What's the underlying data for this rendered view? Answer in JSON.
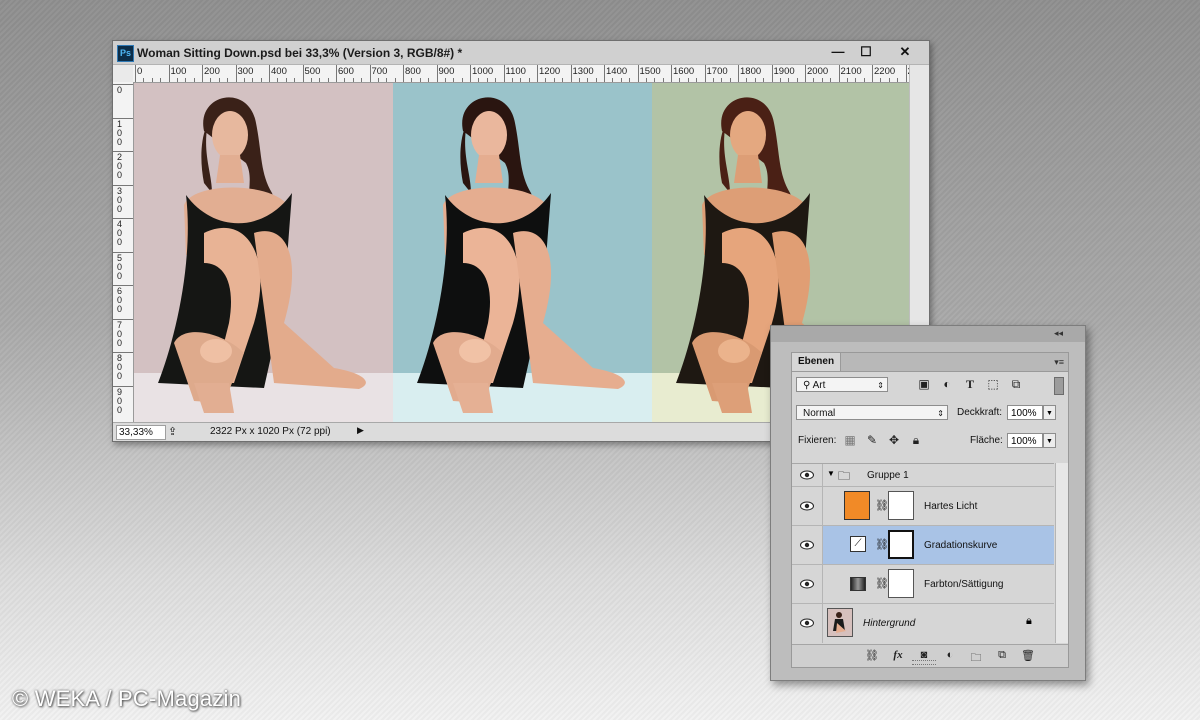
{
  "document": {
    "title": "Woman Sitting Down.psd bei 33,3% (Version 3, RGB/8#) *",
    "app_icon": "Ps",
    "window_controls": {
      "minimize": "—",
      "maximize": "☐",
      "close": "✕"
    },
    "ruler_h_labels": [
      "0",
      "100",
      "200",
      "300",
      "400",
      "500",
      "600",
      "700",
      "800",
      "900",
      "1000",
      "1100",
      "1200",
      "1300",
      "1400",
      "1500",
      "1600",
      "1700",
      "1800",
      "1900",
      "2000",
      "2100",
      "2200",
      "2"
    ],
    "ruler_v_labels": [
      "0",
      "1\n0\n0",
      "2\n0\n0",
      "3\n0\n0",
      "4\n0\n0",
      "5\n0\n0",
      "6\n0\n0",
      "7\n0\n0",
      "8\n0\n0",
      "9\n0\n0"
    ],
    "zoom": "33,33%",
    "doc_info": "2322 Px x 1020 Px (72 ppi)",
    "panels": [
      {
        "bg": "#d4c2c3",
        "tint": "none"
      },
      {
        "bg": "#9cc4cb",
        "tint": "cool"
      },
      {
        "bg": "#b3c3a7",
        "tint": "warm"
      }
    ]
  },
  "layers_panel": {
    "tab_label": "Ebenen",
    "collapse_icon": "◂◂",
    "menu_icon": "▾≡",
    "filter_label": "Art",
    "filter_icons": [
      "image-icon",
      "adjustment-icon",
      "T",
      "shape-icon",
      "smart-object-icon"
    ],
    "blend_mode": "Normal",
    "opacity_label": "Deckkraft:",
    "opacity_value": "100%",
    "lock_label": "Fixieren:",
    "fill_label": "Fläche:",
    "fill_value": "100%",
    "group": {
      "name": "Gruppe 1"
    },
    "layers": [
      {
        "name": "Hartes Licht",
        "type": "fill",
        "color": "#f18a27"
      },
      {
        "name": "Gradationskurve",
        "type": "curves",
        "selected": true
      },
      {
        "name": "Farbton/Sättigung",
        "type": "hue-saturation"
      },
      {
        "name": "Hintergrund",
        "type": "background",
        "locked": true
      }
    ],
    "bottom_icons": [
      "link-icon",
      "fx",
      "mask-icon",
      "adjustment-icon",
      "folder-icon",
      "new-layer-icon",
      "trash-icon"
    ]
  },
  "watermark": "© WEKA / PC-Magazin"
}
